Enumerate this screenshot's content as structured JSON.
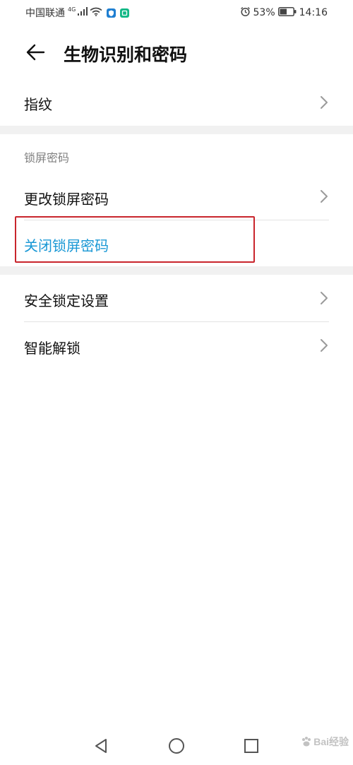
{
  "status_bar": {
    "carrier": "中国联通",
    "network_type": "4G",
    "battery_percent": "53%",
    "time": "14:16",
    "battery_level": 0.53,
    "icons": [
      "signal-icon",
      "wifi-icon",
      "shield-app-icon",
      "app-badge-icon",
      "alarm-icon",
      "battery-icon"
    ]
  },
  "header": {
    "title": "生物识别和密码",
    "back_icon": "back-arrow-icon"
  },
  "items": {
    "fingerprint": "指纹",
    "lock_section_header": "锁屏密码",
    "change_lock_password": "更改锁屏密码",
    "disable_lock_password": "关闭锁屏密码",
    "security_lock_settings": "安全锁定设置",
    "smart_unlock": "智能解锁"
  },
  "nav_bar": {
    "back": "nav-back-icon",
    "home": "nav-home-icon",
    "recents": "nav-recents-icon"
  },
  "watermark": {
    "text": "Bai经验",
    "logo": "baidu-paw-logo"
  },
  "colors": {
    "accent": "#1a98d5",
    "highlight_border": "#c9252c",
    "section_gap": "#f1f1f1",
    "divider": "#e3e3e3"
  }
}
